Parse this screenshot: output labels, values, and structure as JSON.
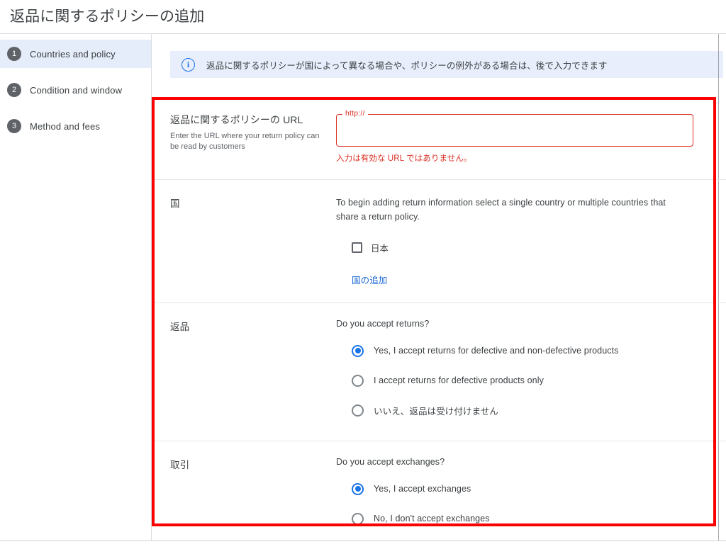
{
  "window": {
    "title": "返品に関するポリシーの追加"
  },
  "sidebar": {
    "steps": [
      {
        "num": "1",
        "label": "Countries and policy",
        "active": true
      },
      {
        "num": "2",
        "label": "Condition and window",
        "active": false
      },
      {
        "num": "3",
        "label": "Method and fees",
        "active": false
      }
    ]
  },
  "banner": {
    "icon": "info-icon",
    "text": "返品に関するポリシーが国によって異なる場合や、ポリシーの例外がある場合は、後で入力できます"
  },
  "sections": {
    "url": {
      "label": "返品に関するポリシーの URL",
      "help": "Enter the URL where your return policy can be read by customers",
      "floating_label": "http://",
      "value": "",
      "placeholder": "",
      "error": "入力は有効な URL ではありません。"
    },
    "country": {
      "label": "国",
      "description": "To begin adding return information select a single country or multiple countries that share a return policy.",
      "checkbox_label": "日本",
      "checkbox_checked": false,
      "add_link": "国の追加"
    },
    "returns": {
      "label": "返品",
      "question": "Do you accept returns?",
      "options": [
        {
          "label": "Yes, I accept returns for defective and non-defective products",
          "selected": true
        },
        {
          "label": "I accept returns for defective products only",
          "selected": false
        },
        {
          "label": "いいえ、返品は受け付けません",
          "selected": false
        }
      ]
    },
    "exchanges": {
      "label": "取引",
      "question": "Do you accept exchanges?",
      "options": [
        {
          "label": "Yes, I accept exchanges",
          "selected": true
        },
        {
          "label": "No, I don't accept exchanges",
          "selected": false
        }
      ]
    }
  },
  "colors": {
    "accent": "#1a73e8",
    "link": "#1967d2",
    "error": "#d93025",
    "highlight_box": "#fa0202",
    "banner_bg": "#e8eefb",
    "active_step_bg": "#e6edfa"
  }
}
